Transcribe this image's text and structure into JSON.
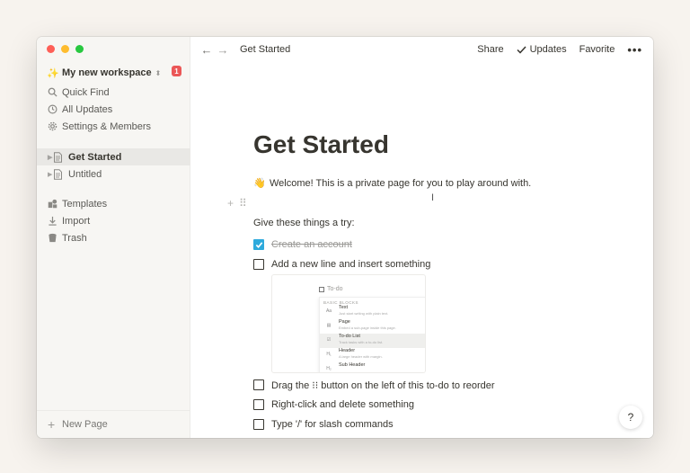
{
  "sidebar": {
    "workspace": {
      "icon": "✨",
      "name": "My new workspace",
      "chevron": "⬍",
      "badge": "1"
    },
    "nav": [
      {
        "label": "Quick Find",
        "icon": "search-icon"
      },
      {
        "label": "All Updates",
        "icon": "clock-icon"
      },
      {
        "label": "Settings & Members",
        "icon": "gear-icon"
      }
    ],
    "pages": [
      {
        "label": "Get Started",
        "active": true
      },
      {
        "label": "Untitled",
        "active": false
      }
    ],
    "tools": [
      {
        "label": "Templates",
        "icon": "templates-icon"
      },
      {
        "label": "Import",
        "icon": "download-icon"
      },
      {
        "label": "Trash",
        "icon": "trash-icon"
      }
    ],
    "new_page": "New Page"
  },
  "topbar": {
    "breadcrumb": "Get Started",
    "share": "Share",
    "updates": "Updates",
    "favorite": "Favorite",
    "more": "•••"
  },
  "page": {
    "title": "Get Started",
    "welcome_emoji": "👋",
    "welcome": "Welcome! This is a private page for you to play around with.",
    "try_heading": "Give these things a try:",
    "todos": [
      {
        "text": "Create an account",
        "checked": true
      },
      {
        "text": "Add a new line and insert something",
        "checked": false
      },
      {
        "text": "Drag the ⁝⁝ button on the left of this to-do to reorder",
        "checked": false
      },
      {
        "text": "Right-click and delete something",
        "checked": false
      },
      {
        "text": "Type '/' for slash commands",
        "checked": false
      }
    ],
    "demo": {
      "placeholder": "To-do",
      "menu_heading": "BASIC BLOCKS",
      "items": [
        {
          "title": "Text",
          "desc": "Just start writing with plain text.",
          "icon": "Aa"
        },
        {
          "title": "Page",
          "desc": "Embed a sub-page inside this page.",
          "icon": "▤"
        },
        {
          "title": "To-do List",
          "desc": "Track tasks with a to-do list.",
          "icon": "☑"
        },
        {
          "title": "Header",
          "desc": "A large header with margin.",
          "icon": "H₁"
        },
        {
          "title": "Sub Header",
          "desc": "",
          "icon": "H₂"
        }
      ]
    },
    "help": "?"
  },
  "colors": {
    "accent": "#2eaadc",
    "badge": "#eb5757",
    "sidebar_bg": "#f7f6f3",
    "text": "#37352f"
  }
}
